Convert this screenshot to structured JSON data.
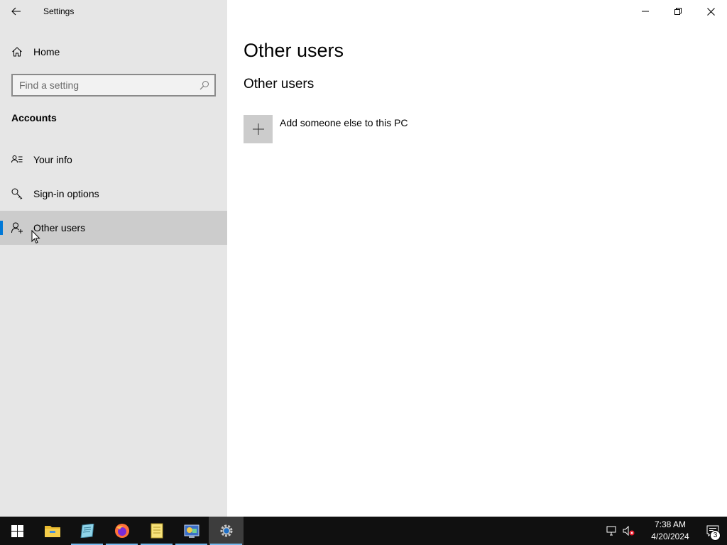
{
  "window": {
    "app_title": "Settings",
    "icons": {
      "back": "back-arrow-icon",
      "minimize": "minimize-icon",
      "restore": "restore-icon",
      "close": "close-icon"
    }
  },
  "sidebar": {
    "home_label": "Home",
    "search": {
      "placeholder": "Find a setting",
      "value": ""
    },
    "section_header": "Accounts",
    "items": [
      {
        "label": "Your info",
        "icon": "contact-card-icon",
        "selected": false
      },
      {
        "label": "Sign-in options",
        "icon": "key-icon",
        "selected": false
      },
      {
        "label": "Other users",
        "icon": "add-person-icon",
        "selected": true
      }
    ]
  },
  "main": {
    "page_title": "Other users",
    "section_title": "Other users",
    "add_user_label": "Add someone else to this PC"
  },
  "taskbar": {
    "apps": [
      "file-explorer-icon",
      "notepad-icon",
      "firefox-icon",
      "notes-icon",
      "control-panel-icon",
      "settings-gear-icon"
    ],
    "clock": {
      "time": "7:38 AM",
      "date": "4/20/2024"
    },
    "notification_count": "3"
  },
  "colors": {
    "accent": "#0078d7",
    "sidebar_bg": "#e6e6e6",
    "selected_bg": "#cccccc",
    "taskbar_bg": "#101010"
  }
}
